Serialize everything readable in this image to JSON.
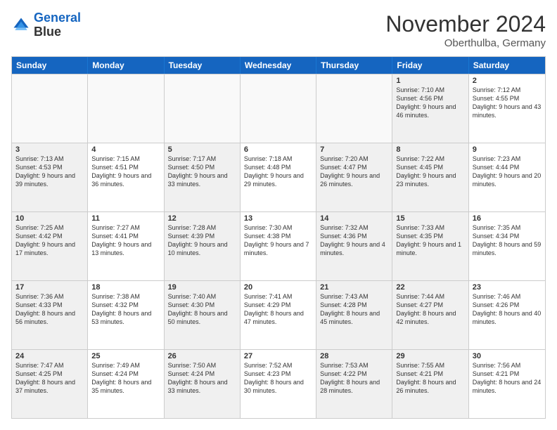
{
  "logo": {
    "line1": "General",
    "line2": "Blue"
  },
  "title": "November 2024",
  "subtitle": "Oberthulba, Germany",
  "header_days": [
    "Sunday",
    "Monday",
    "Tuesday",
    "Wednesday",
    "Thursday",
    "Friday",
    "Saturday"
  ],
  "rows": [
    [
      {
        "day": "",
        "text": "",
        "empty": true
      },
      {
        "day": "",
        "text": "",
        "empty": true
      },
      {
        "day": "",
        "text": "",
        "empty": true
      },
      {
        "day": "",
        "text": "",
        "empty": true
      },
      {
        "day": "",
        "text": "",
        "empty": true
      },
      {
        "day": "1",
        "text": "Sunrise: 7:10 AM\nSunset: 4:56 PM\nDaylight: 9 hours and 46 minutes.",
        "shaded": true
      },
      {
        "day": "2",
        "text": "Sunrise: 7:12 AM\nSunset: 4:55 PM\nDaylight: 9 hours and 43 minutes.",
        "shaded": false
      }
    ],
    [
      {
        "day": "3",
        "text": "Sunrise: 7:13 AM\nSunset: 4:53 PM\nDaylight: 9 hours and 39 minutes.",
        "shaded": true
      },
      {
        "day": "4",
        "text": "Sunrise: 7:15 AM\nSunset: 4:51 PM\nDaylight: 9 hours and 36 minutes.",
        "shaded": false
      },
      {
        "day": "5",
        "text": "Sunrise: 7:17 AM\nSunset: 4:50 PM\nDaylight: 9 hours and 33 minutes.",
        "shaded": true
      },
      {
        "day": "6",
        "text": "Sunrise: 7:18 AM\nSunset: 4:48 PM\nDaylight: 9 hours and 29 minutes.",
        "shaded": false
      },
      {
        "day": "7",
        "text": "Sunrise: 7:20 AM\nSunset: 4:47 PM\nDaylight: 9 hours and 26 minutes.",
        "shaded": true
      },
      {
        "day": "8",
        "text": "Sunrise: 7:22 AM\nSunset: 4:45 PM\nDaylight: 9 hours and 23 minutes.",
        "shaded": true
      },
      {
        "day": "9",
        "text": "Sunrise: 7:23 AM\nSunset: 4:44 PM\nDaylight: 9 hours and 20 minutes.",
        "shaded": false
      }
    ],
    [
      {
        "day": "10",
        "text": "Sunrise: 7:25 AM\nSunset: 4:42 PM\nDaylight: 9 hours and 17 minutes.",
        "shaded": true
      },
      {
        "day": "11",
        "text": "Sunrise: 7:27 AM\nSunset: 4:41 PM\nDaylight: 9 hours and 13 minutes.",
        "shaded": false
      },
      {
        "day": "12",
        "text": "Sunrise: 7:28 AM\nSunset: 4:39 PM\nDaylight: 9 hours and 10 minutes.",
        "shaded": true
      },
      {
        "day": "13",
        "text": "Sunrise: 7:30 AM\nSunset: 4:38 PM\nDaylight: 9 hours and 7 minutes.",
        "shaded": false
      },
      {
        "day": "14",
        "text": "Sunrise: 7:32 AM\nSunset: 4:36 PM\nDaylight: 9 hours and 4 minutes.",
        "shaded": true
      },
      {
        "day": "15",
        "text": "Sunrise: 7:33 AM\nSunset: 4:35 PM\nDaylight: 9 hours and 1 minute.",
        "shaded": true
      },
      {
        "day": "16",
        "text": "Sunrise: 7:35 AM\nSunset: 4:34 PM\nDaylight: 8 hours and 59 minutes.",
        "shaded": false
      }
    ],
    [
      {
        "day": "17",
        "text": "Sunrise: 7:36 AM\nSunset: 4:33 PM\nDaylight: 8 hours and 56 minutes.",
        "shaded": true
      },
      {
        "day": "18",
        "text": "Sunrise: 7:38 AM\nSunset: 4:32 PM\nDaylight: 8 hours and 53 minutes.",
        "shaded": false
      },
      {
        "day": "19",
        "text": "Sunrise: 7:40 AM\nSunset: 4:30 PM\nDaylight: 8 hours and 50 minutes.",
        "shaded": true
      },
      {
        "day": "20",
        "text": "Sunrise: 7:41 AM\nSunset: 4:29 PM\nDaylight: 8 hours and 47 minutes.",
        "shaded": false
      },
      {
        "day": "21",
        "text": "Sunrise: 7:43 AM\nSunset: 4:28 PM\nDaylight: 8 hours and 45 minutes.",
        "shaded": true
      },
      {
        "day": "22",
        "text": "Sunrise: 7:44 AM\nSunset: 4:27 PM\nDaylight: 8 hours and 42 minutes.",
        "shaded": true
      },
      {
        "day": "23",
        "text": "Sunrise: 7:46 AM\nSunset: 4:26 PM\nDaylight: 8 hours and 40 minutes.",
        "shaded": false
      }
    ],
    [
      {
        "day": "24",
        "text": "Sunrise: 7:47 AM\nSunset: 4:25 PM\nDaylight: 8 hours and 37 minutes.",
        "shaded": true
      },
      {
        "day": "25",
        "text": "Sunrise: 7:49 AM\nSunset: 4:24 PM\nDaylight: 8 hours and 35 minutes.",
        "shaded": false
      },
      {
        "day": "26",
        "text": "Sunrise: 7:50 AM\nSunset: 4:24 PM\nDaylight: 8 hours and 33 minutes.",
        "shaded": true
      },
      {
        "day": "27",
        "text": "Sunrise: 7:52 AM\nSunset: 4:23 PM\nDaylight: 8 hours and 30 minutes.",
        "shaded": false
      },
      {
        "day": "28",
        "text": "Sunrise: 7:53 AM\nSunset: 4:22 PM\nDaylight: 8 hours and 28 minutes.",
        "shaded": true
      },
      {
        "day": "29",
        "text": "Sunrise: 7:55 AM\nSunset: 4:21 PM\nDaylight: 8 hours and 26 minutes.",
        "shaded": true
      },
      {
        "day": "30",
        "text": "Sunrise: 7:56 AM\nSunset: 4:21 PM\nDaylight: 8 hours and 24 minutes.",
        "shaded": false
      }
    ]
  ]
}
